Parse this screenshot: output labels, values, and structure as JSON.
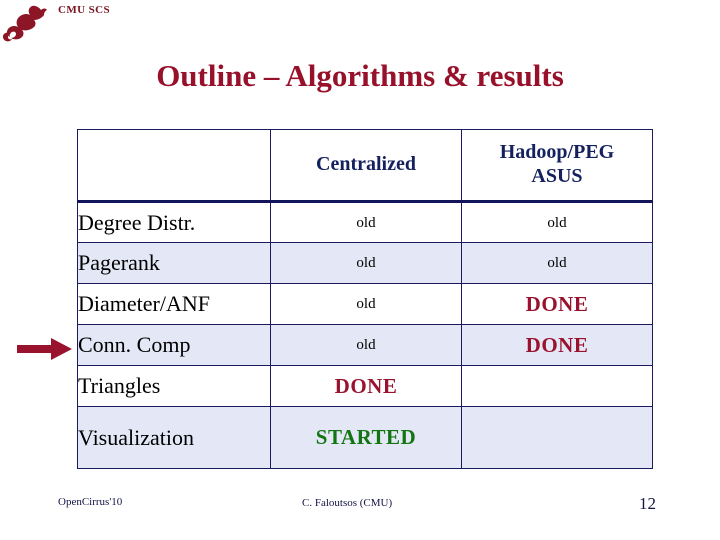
{
  "brand": {
    "label": "CMU SCS",
    "logo_icon": "scs-dragon-logo-icon",
    "color": "#7b1320"
  },
  "slide": {
    "title": "Outline – Algorithms & results",
    "title_color": "#97112b"
  },
  "pointer": {
    "icon": "right-arrow-icon",
    "color": "#99132f",
    "points_at_row": "Conn. Comp"
  },
  "table": {
    "columns": [
      {
        "key": "task",
        "label": ""
      },
      {
        "key": "centralized",
        "label": "Centralized"
      },
      {
        "key": "hadoop",
        "label": "Hadoop/PEG\nASUS",
        "line1": "Hadoop/PEG",
        "line2": "ASUS"
      }
    ],
    "header_color": "#14215e",
    "border_color": "#14145a",
    "shade_color": "#e4e8f6",
    "rows": [
      {
        "task": "Degree Distr.",
        "centralized": "old",
        "centralized_state": "old",
        "hadoop": "old",
        "hadoop_state": "old",
        "shaded": false
      },
      {
        "task": "Pagerank",
        "centralized": "old",
        "centralized_state": "old",
        "hadoop": "old",
        "hadoop_state": "old",
        "shaded": true
      },
      {
        "task": "Diameter/ANF",
        "centralized": "old",
        "centralized_state": "old",
        "hadoop": "DONE",
        "hadoop_state": "done",
        "shaded": false
      },
      {
        "task": "Conn. Comp",
        "centralized": "old",
        "centralized_state": "old",
        "hadoop": "DONE",
        "hadoop_state": "done",
        "shaded": true
      },
      {
        "task": "Triangles",
        "centralized": "DONE",
        "centralized_state": "done",
        "hadoop": "",
        "hadoop_state": "empty",
        "shaded": false
      },
      {
        "task": "Visualization",
        "centralized": "STARTED",
        "centralized_state": "started",
        "hadoop": "",
        "hadoop_state": "empty",
        "shaded": true
      }
    ],
    "state_colors": {
      "old": "#000000",
      "done": "#99132f",
      "started": "#127512"
    }
  },
  "footer": {
    "left": "OpenCirrus'10",
    "center": "C. Faloutsos (CMU)",
    "page": "12",
    "color": "#141446"
  }
}
